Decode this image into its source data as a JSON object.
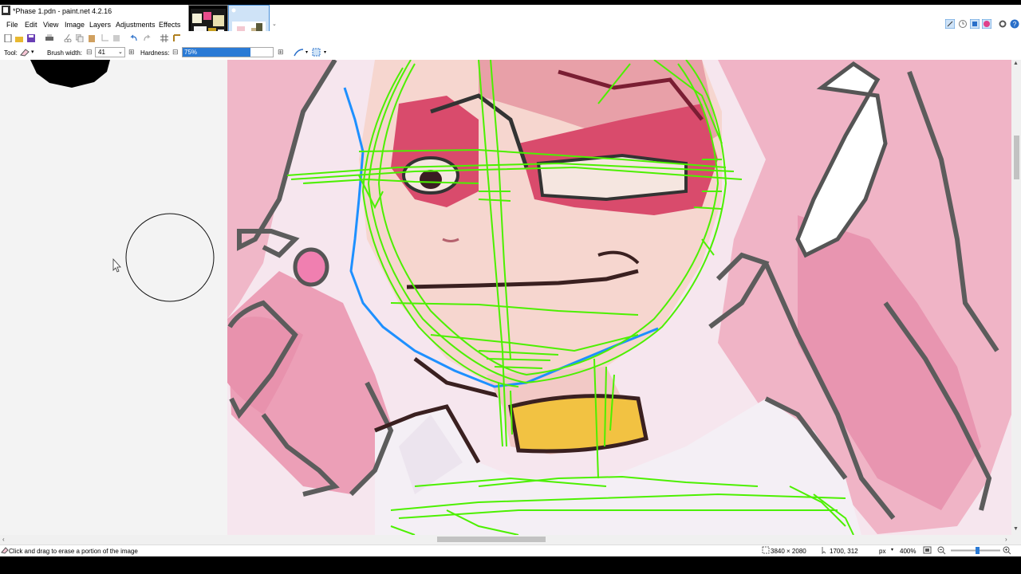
{
  "window": {
    "title": "*Phase 1.pdn - paint.net 4.2.16"
  },
  "menu": {
    "items": [
      "File",
      "Edit",
      "View",
      "Image",
      "Layers",
      "Adjustments",
      "Effects"
    ]
  },
  "tool_options": {
    "tool_label": "Tool:",
    "brush_width_label": "Brush width:",
    "brush_width_value": "41",
    "hardness_label": "Hardness:",
    "hardness_text": "75%",
    "hardness_percent": 75
  },
  "status": {
    "hint": "Click and drag to erase a portion of the image",
    "image_size": "3840 × 2080",
    "cursor_pos": "1700, 312",
    "units": "px",
    "zoom": "400%"
  },
  "colors": {
    "accent": "#2a7ad5",
    "sketch_green": "#4cf000",
    "sketch_blue": "#1e90ff"
  },
  "icons": [
    "app-icon",
    "new-icon",
    "open-icon",
    "save-icon",
    "print-icon",
    "cut-icon",
    "copy-icon",
    "paste-icon",
    "crop-icon",
    "deselect-icon",
    "undo-icon",
    "redo-icon",
    "grid-icon",
    "ruler-icon",
    "eraser-icon",
    "antialias-icon",
    "blend-icon",
    "tools-icon",
    "history-icon",
    "layers-icon",
    "colors-icon",
    "settings-icon",
    "help-icon",
    "zoom-out-icon",
    "zoom-in-icon"
  ]
}
